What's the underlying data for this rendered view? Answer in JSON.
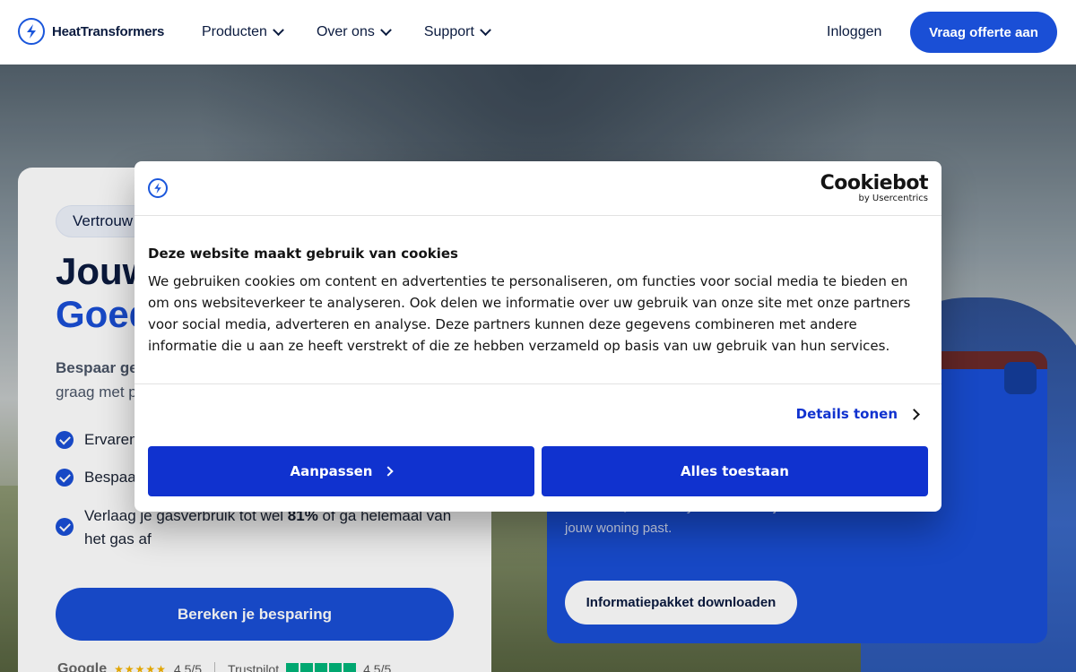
{
  "nav": {
    "logo_text": "HeatTransformers",
    "menu": [
      "Producten",
      "Over ons",
      "Support"
    ],
    "login": "Inloggen",
    "cta": "Vraag offerte aan"
  },
  "hero": {
    "pill": "Vertrouw",
    "title_line1": "Jouw",
    "title_line2": "Goed",
    "lead_bold": "Bespaar ge",
    "lead_rest": "graag met p",
    "bullets": [
      {
        "text": "Ervaren"
      },
      {
        "text": "Bespaa"
      },
      {
        "text_before": "Verlaag je gasverbruik tot wel ",
        "bold": "81%",
        "text_after": " of ga helemaal van het gas af"
      }
    ],
    "primary_button": "Bereken je besparing",
    "ratings": {
      "google_label": "Google",
      "google_score": "4,5/5",
      "trustpilot_label": "Trustpilot",
      "trustpilot_score": "4,5/5"
    }
  },
  "info_card": {
    "text": "hoofd ziet, en welk systeem écht bij jouw woning past.",
    "button": "Informatiepakket downloaden"
  },
  "cookie_dialog": {
    "brand": "Cookiebot",
    "brand_sub": "by Usercentrics",
    "title": "Deze website maakt gebruik van cookies",
    "body": "We gebruiken cookies om content en advertenties te personaliseren, om functies voor social media te bieden en om ons websiteverkeer te analyseren. Ook delen we informatie over uw gebruik van onze site met onze partners voor social media, adverteren en analyse. Deze partners kunnen deze gegevens combineren met andere informatie die u aan ze heeft verstrekt of die ze hebben verzameld op basis van uw gebruik van hun services.",
    "details_link": "Details tonen",
    "customize_button": "Aanpassen",
    "allow_all_button": "Alles toestaan"
  },
  "colors": {
    "brand_blue": "#1a4fd6",
    "cookiebot_blue": "#1032cf",
    "navy": "#0b1b3f"
  }
}
